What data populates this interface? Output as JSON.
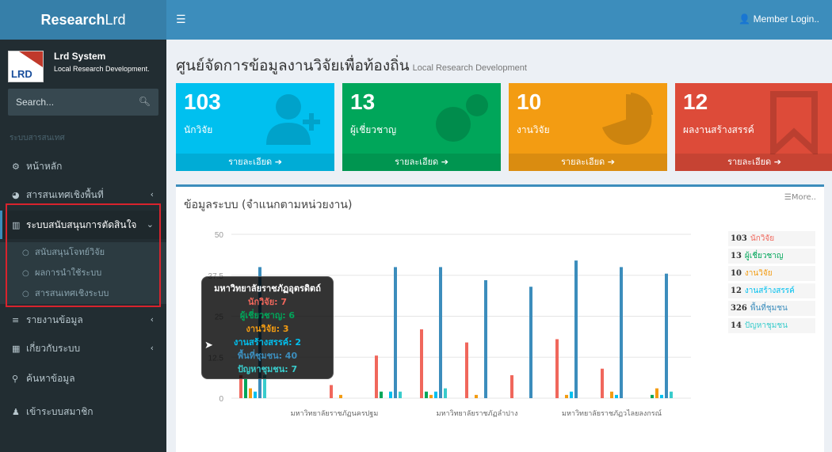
{
  "header": {
    "logo_bold": "Research",
    "logo_rest": "Lrd",
    "member": "👤 Member Login.."
  },
  "user_panel": {
    "name": "Lrd System",
    "sub": "Local Research Development."
  },
  "search": {
    "placeholder": "Search..."
  },
  "sidebar": {
    "header": "ระบบสารสนเทศ",
    "items": [
      {
        "label": "หน้าหลัก",
        "icon": "dashboard-icon"
      },
      {
        "label": "สารสนเทศเชิงพื้นที่",
        "icon": "globe-icon"
      },
      {
        "label": "ระบบสนับสนุนการตัดสินใจ",
        "icon": "bar-chart-icon"
      },
      {
        "label": "รายงานข้อมูล",
        "icon": "list-icon"
      },
      {
        "label": "เกี่ยวกับระบบ",
        "icon": "grid-icon"
      },
      {
        "label": "ค้นหาข้อมูล",
        "icon": "search-icon"
      },
      {
        "label": "เข้าระบบสมาชิก",
        "icon": "user-icon"
      }
    ],
    "subitems": [
      "สนับสนุนโจทย์วิจัย",
      "ผลการนำใช้ระบบ",
      "สารสนเทศเชิงระบบ"
    ]
  },
  "page": {
    "title": "ศูนย์จัดการข้อมูลงานวิจัยเพื่อท้องถิ่น",
    "subtitle": "Local Research Development"
  },
  "stats": [
    {
      "num": "103",
      "label": "นักวิจัย",
      "foot": "รายละเอียด ➔",
      "color": "#00c0ef"
    },
    {
      "num": "13",
      "label": "ผู้เชี่ยวชาญ",
      "foot": "รายละเอียด ➔",
      "color": "#00a65a"
    },
    {
      "num": "10",
      "label": "งานวิจัย",
      "foot": "รายละเอียด ➔",
      "color": "#f39c12"
    },
    {
      "num": "12",
      "label": "ผลงานสร้างสรรค์",
      "foot": "รายละเอียด ➔",
      "color": "#dd4b39"
    }
  ],
  "panel": {
    "title": "ข้อมูลระบบ (จำแนกตามหน่วยงาน)",
    "more": "☰More.."
  },
  "legend": [
    {
      "num": "103",
      "label": "นักวิจัย",
      "color": "#f0675c"
    },
    {
      "num": "13",
      "label": "ผู้เชี่ยวชาญ",
      "color": "#00a65a"
    },
    {
      "num": "10",
      "label": "งานวิจัย",
      "color": "#f39c12"
    },
    {
      "num": "12",
      "label": "งานสร้างสรรค์",
      "color": "#00c0ef"
    },
    {
      "num": "326",
      "label": "พื้นที่ชุมชน",
      "color": "#3c8dbc"
    },
    {
      "num": "14",
      "label": "ปัญหาชุมชน",
      "color": "#39cccc"
    }
  ],
  "tooltip": {
    "title": "มหาวิทยาลัยราชภัฏอุตรดิตถ์",
    "lines": [
      {
        "text": "นักวิจัย: 7",
        "color": "#f0675c"
      },
      {
        "text": "ผู้เชี่ยวชาญ: 6",
        "color": "#00a65a"
      },
      {
        "text": "งานวิจัย: 3",
        "color": "#f39c12"
      },
      {
        "text": "งานสร้างสรรค์: 2",
        "color": "#00c0ef"
      },
      {
        "text": "พื้นที่ชุมชน: 40",
        "color": "#3c8dbc"
      },
      {
        "text": "ปัญหาชุมชน: 7",
        "color": "#39cccc"
      }
    ]
  },
  "chart_data": {
    "type": "bar",
    "ylim": [
      0,
      50
    ],
    "ticks": [
      "0",
      "12.5",
      "25",
      "37.5",
      "50"
    ],
    "xlabels": [
      "มหาวิทยาลัยราชภัฏนครปฐม",
      "มหาวิทยาลัยราชภัฏลำปาง",
      "มหาวิทยาลัยราชภัฏวไลยลงกรณ์"
    ],
    "series_colors": [
      "#f0675c",
      "#00a65a",
      "#f39c12",
      "#00c0ef",
      "#3c8dbc",
      "#39cccc"
    ],
    "groups": [
      [
        7,
        6,
        3,
        2,
        40,
        7
      ],
      [
        0,
        0,
        0,
        0,
        0,
        0
      ],
      [
        4,
        0,
        1,
        0,
        0,
        0
      ],
      [
        13,
        2,
        0,
        2,
        40,
        2
      ],
      [
        21,
        2,
        1,
        2,
        40,
        3
      ],
      [
        17,
        0,
        1,
        0,
        36,
        0
      ],
      [
        7,
        0,
        0,
        0,
        34,
        0
      ],
      [
        18,
        0,
        1,
        2,
        42,
        0
      ],
      [
        9,
        0,
        2,
        1,
        40,
        0
      ],
      [
        0,
        1,
        3,
        1,
        38,
        2
      ]
    ]
  }
}
